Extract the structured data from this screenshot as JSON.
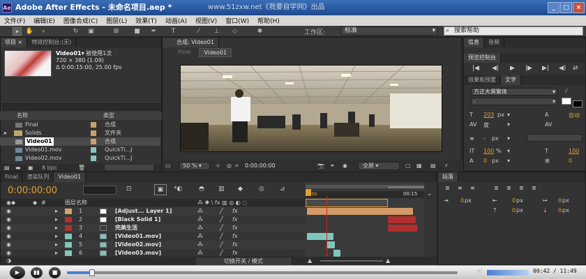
{
  "app": {
    "title": "Adobe After Effects - 未命名项目.aep *",
    "watermark": "www.51zxw.net《我要自学网》出品",
    "logo": "Ae"
  },
  "menu": [
    "文件(F)",
    "编辑(E)",
    "图像合成(C)",
    "图层(L)",
    "效果(T)",
    "动画(A)",
    "视图(V)",
    "窗口(W)",
    "帮助(H)"
  ],
  "toolbar": {
    "workspace_label": "工作区:",
    "workspace_value": "标准",
    "search_placeholder": "搜索帮助"
  },
  "project": {
    "tabs": [
      "项目 ×",
      "特效控制台:(无)"
    ],
    "item_name": "Video01▾",
    "used": "被使用1次",
    "size": "720 × 380 (1.09)",
    "duration": "Δ 0:00:15:00, 25.00 fps",
    "columns": {
      "name": "名称",
      "type": "类型"
    },
    "items": [
      {
        "name": "Final",
        "type": "合成"
      },
      {
        "name": "Solids",
        "type": "文件夹"
      },
      {
        "name": "Video01",
        "type": "合成"
      },
      {
        "name": "Video01.mov",
        "type": "QuickTi...J"
      },
      {
        "name": "Video02.mov",
        "type": "QuickTi...J"
      }
    ],
    "bpc": "8 bpc"
  },
  "viewer": {
    "tab": "合成: Video01",
    "breadcrumbs": [
      "Final",
      "Video01"
    ],
    "zoom": "50 %",
    "time": "0:00:00:00",
    "res": "全屏"
  },
  "right": {
    "info_tabs": [
      "信息",
      "音频"
    ],
    "preview_tab": "预览控制台",
    "effects_tab": "效果和预置",
    "text_tab": "文字",
    "font": "方正大黑繁体",
    "font_style": "-",
    "font_size": "203",
    "px": "px",
    "auto": "自动",
    "tracking": "度",
    "tracking2": "px",
    "scale_v": "100",
    "scale_h": "100",
    "percent": "%",
    "baseline": "0",
    "tsume": "0"
  },
  "timeline": {
    "tabs": [
      "Final",
      "渲染队列",
      "Video01"
    ],
    "time": "0:00:00:00",
    "col_name": "图层名称",
    "ruler_start": "00s",
    "switches": "切换开关 / 模式",
    "layers": [
      {
        "num": "1",
        "name": "[Adjust... Layer 1]",
        "color": "#d4a26e"
      },
      {
        "num": "2",
        "name": "[Black Solid 1]",
        "color": "#b23030"
      },
      {
        "num": "3",
        "name": "完美生活",
        "color": "#b23030"
      },
      {
        "num": "4",
        "name": "[Video01.mov]",
        "color": "#7fc6b9"
      },
      {
        "num": "5",
        "name": "[Video02.mov]",
        "color": "#7fc6b9"
      },
      {
        "num": "6",
        "name": "[Video03.mov]",
        "color": "#7fc6b9"
      }
    ]
  },
  "paragraph": {
    "tab": "段落",
    "v1": "0",
    "v2": "0",
    "v3": "0",
    "v4": "0",
    "v5": "0",
    "unit": "px"
  },
  "player": {
    "time": "00:42 / 11:49"
  }
}
